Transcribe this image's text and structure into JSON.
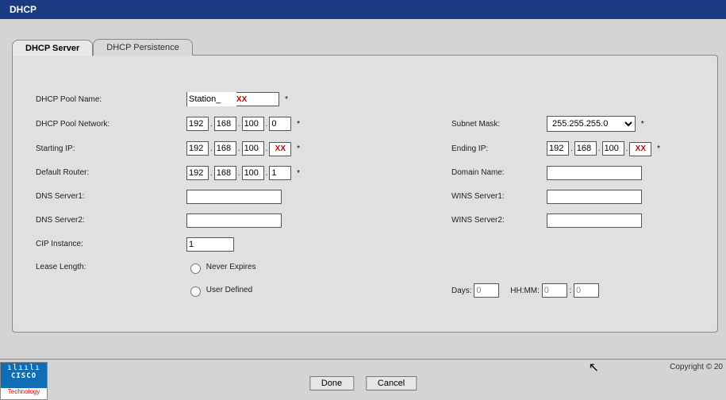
{
  "title": "DHCP",
  "tabs": {
    "server": "DHCP Server",
    "persistence": "DHCP Persistence"
  },
  "labels": {
    "pool_name": "DHCP Pool Name:",
    "pool_network": "DHCP Pool Network:",
    "subnet_mask": "Subnet Mask:",
    "starting_ip": "Starting IP:",
    "ending_ip": "Ending IP:",
    "default_router": "Default Router:",
    "domain_name": "Domain Name:",
    "dns1": "DNS Server1:",
    "wins1": "WINS Server1:",
    "dns2": "DNS Server2:",
    "wins2": "WINS Server2:",
    "cip": "CIP Instance:",
    "lease": "Lease Length:",
    "never": "Never Expires",
    "user": "User Defined",
    "days": "Days:",
    "hhmm": "HH:MM:"
  },
  "values": {
    "pool_name": "Station_",
    "net": {
      "a": "192",
      "b": "168",
      "c": "100",
      "d": "0"
    },
    "subnet_mask": "255.255.255.0",
    "start": {
      "a": "192",
      "b": "168",
      "c": "100",
      "d": ""
    },
    "end": {
      "a": "192",
      "b": "168",
      "c": "100",
      "d": ""
    },
    "router": {
      "a": "192",
      "b": "168",
      "c": "100",
      "d": "1"
    },
    "domain_name": "",
    "dns1": "",
    "dns2": "",
    "wins1": "",
    "wins2": "",
    "cip": "1",
    "days": "0",
    "hh": "0",
    "mm": "0"
  },
  "markers": {
    "xx": "XX",
    "req": "*",
    "dot": ".",
    "colon": ":"
  },
  "buttons": {
    "done": "Done",
    "cancel": "Cancel"
  },
  "footer": {
    "copyright": "Copyright © 20",
    "brand_top": "ılıılı",
    "brand_mid": "CISCO",
    "brand_bottom": "Technology"
  }
}
